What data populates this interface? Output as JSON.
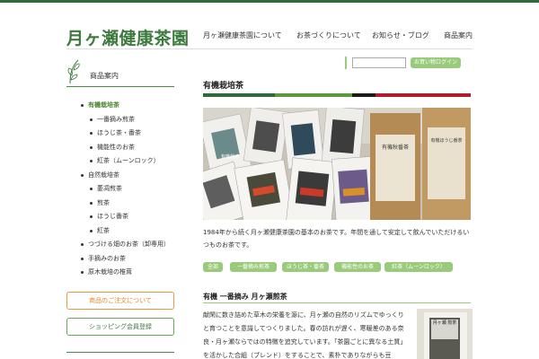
{
  "site": {
    "logo": "月ヶ瀬健康茶園"
  },
  "nav": [
    {
      "label": "月ヶ瀬健康茶園について"
    },
    {
      "label": "お茶づくりについて"
    },
    {
      "label": "お知らせ・ブログ"
    },
    {
      "label": "商品案内"
    }
  ],
  "login": {
    "button_label": "お買い物ログイン",
    "input_value": ""
  },
  "sidebar": {
    "title": "商品案内",
    "items": [
      {
        "label": "有機栽培茶",
        "level": 1,
        "active": true
      },
      {
        "label": "一番摘み煎茶",
        "level": 2
      },
      {
        "label": "ほうじ茶・番茶",
        "level": 2
      },
      {
        "label": "機能性のお茶",
        "level": 2
      },
      {
        "label": "紅茶（ムーンロック）",
        "level": 2
      },
      {
        "label": "自然栽培茶",
        "level": 1
      },
      {
        "label": "萎凋煎茶",
        "level": 2
      },
      {
        "label": "煎茶",
        "level": 2
      },
      {
        "label": "ほうじ番茶",
        "level": 2
      },
      {
        "label": "紅茶",
        "level": 2
      },
      {
        "label": "つづける畑のお茶（卸専用）",
        "level": 1
      },
      {
        "label": "手摘みのお茶",
        "level": 1
      },
      {
        "label": "原木栽培の椎茸",
        "level": 1
      }
    ],
    "order_button": "商品のご注文について",
    "member_button": "ショッピング会員登録"
  },
  "main": {
    "title": "有機栽培茶",
    "intro": "1984年から続く月ヶ瀬健康茶園の基本のお茶です。年間を通して安定して飲んでいただけるいつものお茶です。",
    "tags": [
      "全部",
      "一番摘み煎茶",
      "ほうじ茶・番茶",
      "機能性のお茶",
      "紅茶（ムーンロック）"
    ],
    "section_title": "有機 一番摘み 月ヶ瀬煎茶",
    "section_body": "献閑に数き詰めた草木の栄養を源に、月ヶ瀬の自然のリズムでゆっくりと育つことを意識してつくりました。春の訪れが遅く、寒暖差のある奈良・月ヶ瀬ならではの特徴を追究しています。「茶園ごとに異なる土質」を活かした合組（ブレンド）をすることで、素朴でありながらも豆"
  },
  "photo": {
    "bag_labels": [
      "有機栽培",
      "有機秋番茶",
      "有機ほうじ番茶"
    ]
  },
  "thumb": {
    "label": "月ヶ瀬 煎茶"
  },
  "colors": {
    "brand_green": "#3d7a3e",
    "tag_green": "#9acb7a",
    "order_orange": "#e79a3c",
    "stripe": [
      "#2f6b3a",
      "#5a9a3a",
      "#1a1a1a",
      "#b01e2e"
    ]
  }
}
